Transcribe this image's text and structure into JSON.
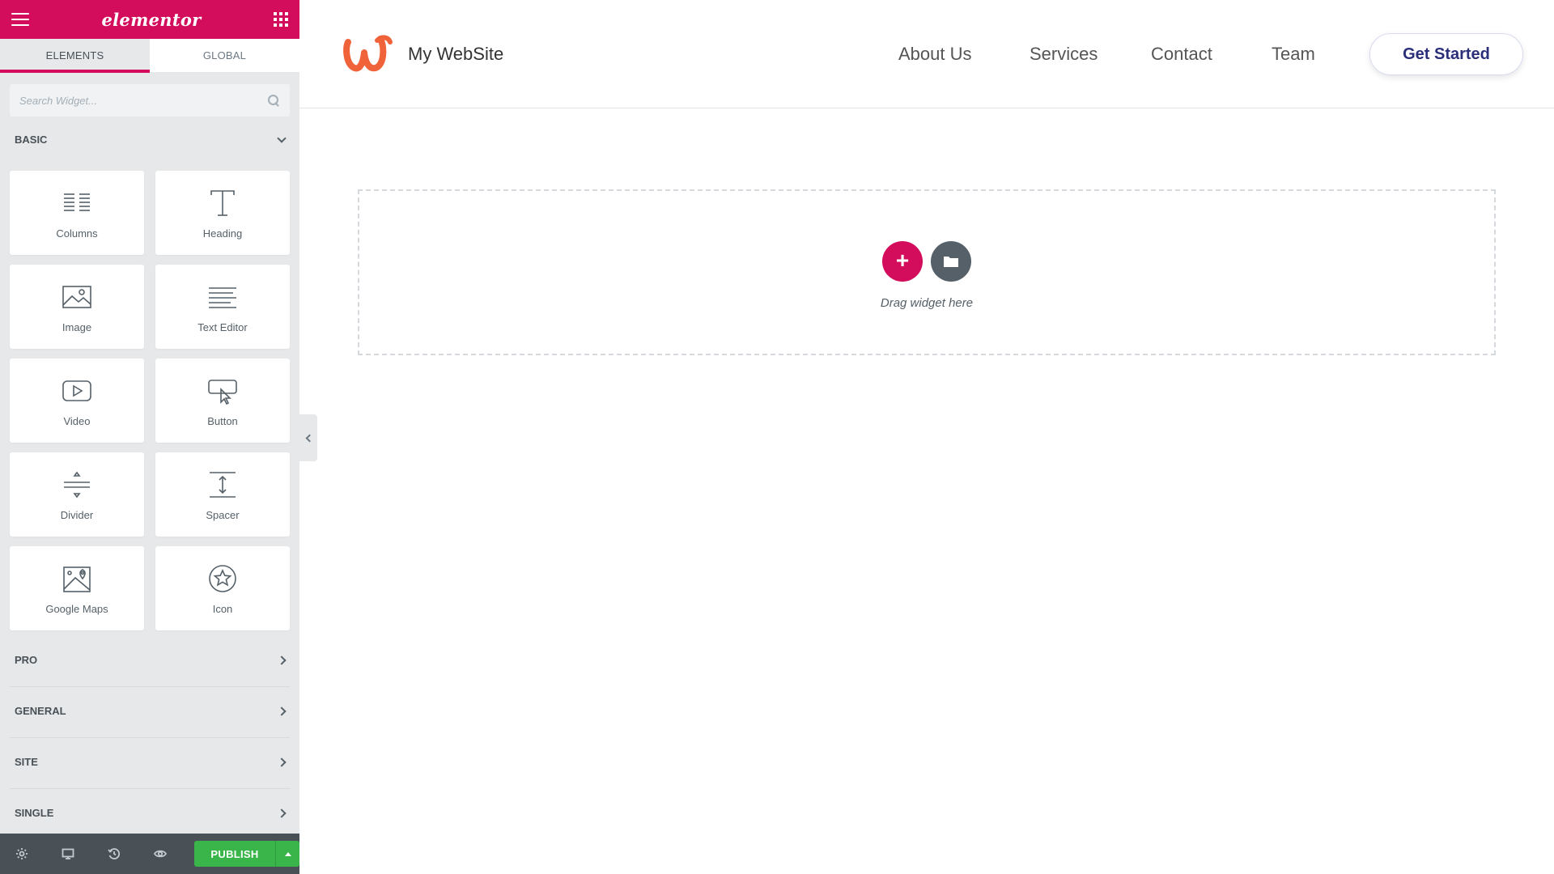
{
  "app": {
    "logo_text": "elementor"
  },
  "tabs": [
    {
      "label": "ELEMENTS",
      "active": true
    },
    {
      "label": "GLOBAL",
      "active": false
    }
  ],
  "search": {
    "placeholder": "Search Widget...",
    "value": ""
  },
  "categories": {
    "basic": "BASIC",
    "pro": "PRO",
    "general": "GENERAL",
    "site": "SITE",
    "single": "SINGLE"
  },
  "widgets": [
    {
      "label": "Columns",
      "icon": "columns-icon"
    },
    {
      "label": "Heading",
      "icon": "heading-icon"
    },
    {
      "label": "Image",
      "icon": "image-icon"
    },
    {
      "label": "Text Editor",
      "icon": "text-editor-icon"
    },
    {
      "label": "Video",
      "icon": "video-icon"
    },
    {
      "label": "Button",
      "icon": "button-icon"
    },
    {
      "label": "Divider",
      "icon": "divider-icon"
    },
    {
      "label": "Spacer",
      "icon": "spacer-icon"
    },
    {
      "label": "Google Maps",
      "icon": "google-maps-icon"
    },
    {
      "label": "Icon",
      "icon": "star-icon"
    }
  ],
  "footer": {
    "icons": [
      "gear-icon",
      "desktop-icon",
      "history-icon",
      "eye-icon"
    ],
    "publish_label": "PUBLISH"
  },
  "site": {
    "name": "My WebSite",
    "nav": [
      "About Us",
      "Services",
      "Contact",
      "Team"
    ],
    "cta_label": "Get Started"
  },
  "canvas": {
    "drop_text": "Drag widget here"
  },
  "colors": {
    "brand": "#d30c5c",
    "publish": "#39b54a",
    "panel_bg": "#e6e8ea",
    "footer_bg": "#495157",
    "site_logo": "#f0623a",
    "cta_text": "#2b2f7a"
  }
}
